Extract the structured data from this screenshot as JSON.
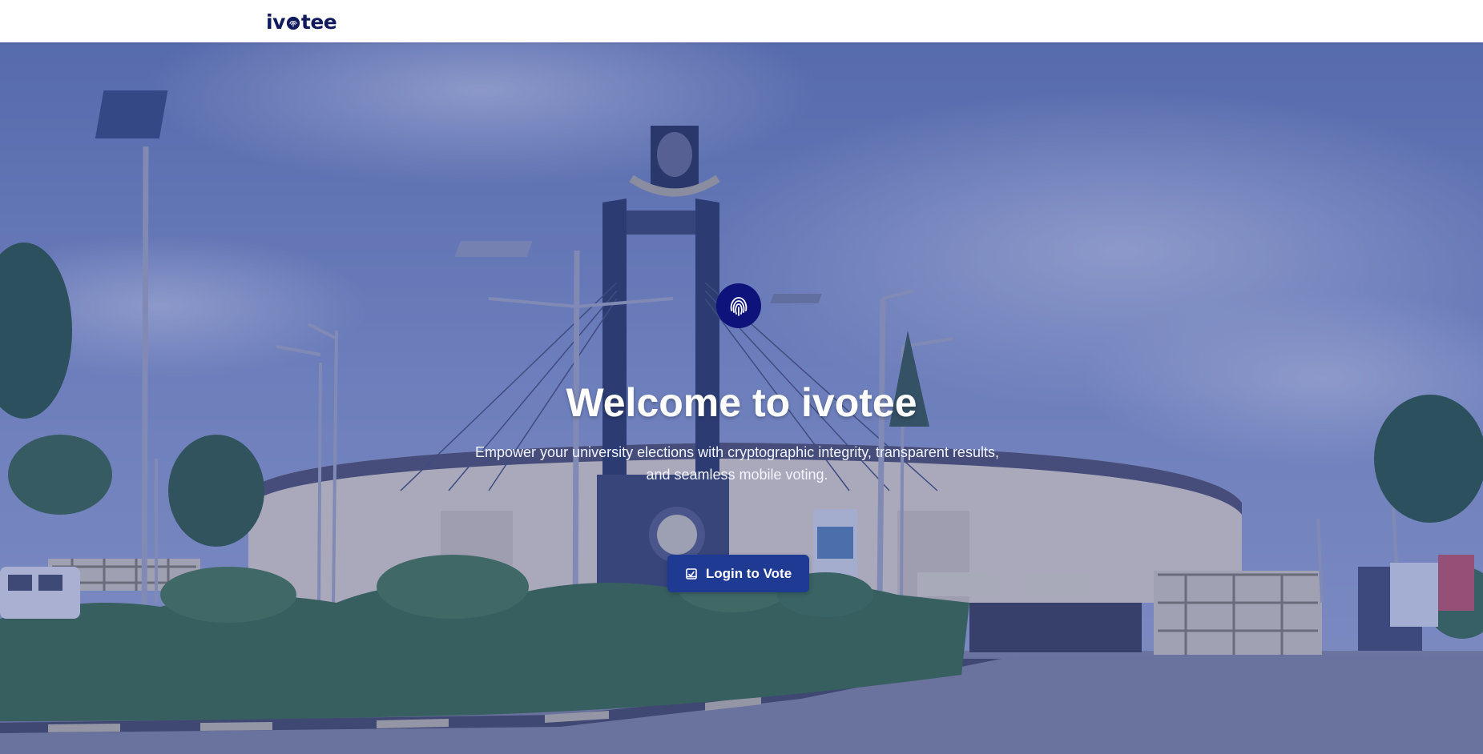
{
  "navbar": {
    "logo_prefix": "iv",
    "logo_suffix": "tee",
    "logo_mark_icon": "fingerprint-o-icon"
  },
  "hero": {
    "badge_icon": "fingerprint-icon",
    "title": "Welcome to ivotee",
    "subtitle": "Empower your university elections with cryptographic integrity, transparent results, and seamless mobile voting.",
    "cta": {
      "label": "Login to Vote",
      "icon": "ballot-check-icon"
    },
    "background": "campus-gate-photo"
  },
  "colors": {
    "brand_navy": "#101a5c",
    "badge": "#0d137a",
    "button": "#1f3a93",
    "overlay": "#283c96"
  }
}
